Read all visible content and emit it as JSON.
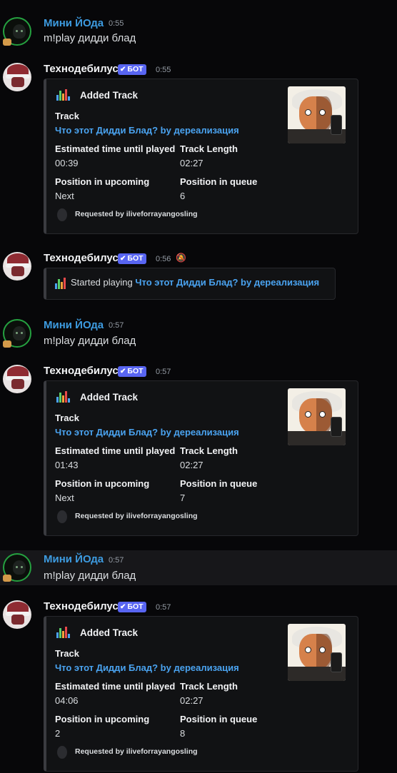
{
  "colors": {
    "user_name": "#3d9be0",
    "bot_tag": "#5865f2",
    "link": "#4aa3f0",
    "eq": [
      "#e84a4a",
      "#f4a53c",
      "#5ad16a",
      "#4ba3f0"
    ]
  },
  "messages": [
    {
      "type": "user",
      "author": "Мини ЙОда",
      "time": "0:55",
      "text": "m!play дидди блад"
    },
    {
      "type": "bot",
      "author": "Технодебилус",
      "tag": "БОТ",
      "time": "0:55",
      "embed": {
        "title": "Added Track",
        "track_label": "Track",
        "track": "Что этот Дидди Блад? by дереализация",
        "est_label": "Estimated time until played",
        "est": "00:39",
        "len_label": "Track Length",
        "len": "02:27",
        "upc_label": "Position in upcoming",
        "upc": "Next",
        "q_label": "Position in queue",
        "q": "6",
        "footer": "Requested by iliveforrayangosling"
      }
    },
    {
      "type": "bot_short",
      "author": "Технодебилус",
      "tag": "БОТ",
      "time": "0:56",
      "started_prefix": "Started playing",
      "started_track": "Что этот Дидди Блад? by дереализация"
    },
    {
      "type": "user",
      "author": "Мини ЙОда",
      "time": "0:57",
      "text": "m!play дидди блад"
    },
    {
      "type": "bot",
      "author": "Технодебилус",
      "tag": "БОТ",
      "time": "0:57",
      "embed": {
        "title": "Added Track",
        "track_label": "Track",
        "track": "Что этот Дидди Блад? by дереализация",
        "est_label": "Estimated time until played",
        "est": "01:43",
        "len_label": "Track Length",
        "len": "02:27",
        "upc_label": "Position in upcoming",
        "upc": "Next",
        "q_label": "Position in queue",
        "q": "7",
        "footer": "Requested by iliveforrayangosling"
      }
    },
    {
      "type": "user",
      "author": "Мини ЙОда",
      "time": "0:57",
      "text": "m!play дидди блад"
    },
    {
      "type": "bot",
      "author": "Технодебилус",
      "tag": "БОТ",
      "time": "0:57",
      "embed": {
        "title": "Added Track",
        "track_label": "Track",
        "track": "Что этот Дидди Блад? by дереализация",
        "est_label": "Estimated time until played",
        "est": "04:06",
        "len_label": "Track Length",
        "len": "02:27",
        "upc_label": "Position in upcoming",
        "upc": "2",
        "q_label": "Position in queue",
        "q": "8",
        "footer": "Requested by iliveforrayangosling"
      }
    }
  ]
}
